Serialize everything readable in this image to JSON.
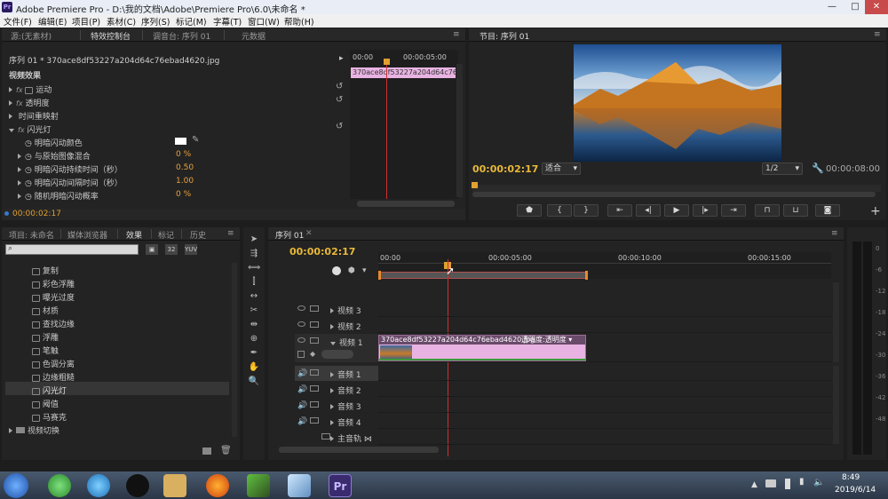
{
  "window": {
    "title": "Adobe Premiere Pro - D:\\我的文档\\Adobe\\Premiere Pro\\6.0\\未命名 *",
    "logo": "Pr"
  },
  "menu": [
    "文件(F)",
    "编辑(E)",
    "项目(P)",
    "素材(C)",
    "序列(S)",
    "标记(M)",
    "字幕(T)",
    "窗口(W)",
    "帮助(H)"
  ],
  "source_panel": {
    "tabs": [
      "源:(无素材)",
      "特效控制台",
      "调音台: 序列 01",
      "元数据"
    ],
    "clip_header": "序列 01 * 370ace8df53227a204d64c76ebad4620.jpg",
    "ruler": {
      "start": "00:00",
      "mid": "00:00:05:00"
    },
    "clip_label": "370ace8df53227a204d64c76ebad",
    "section": "视频效果",
    "effects": [
      {
        "label": "运动",
        "fx": "fx"
      },
      {
        "label": "透明度",
        "fx": "fx"
      },
      {
        "label": "时间重映射",
        "fx": ""
      },
      {
        "label": "闪光灯",
        "fx": "fx"
      }
    ],
    "params": [
      {
        "label": "明暗闪动颜色",
        "value": ""
      },
      {
        "label": "与原始图像混合",
        "value": "0 %"
      },
      {
        "label": "明暗闪动持续时间（秒）",
        "value": "0.50"
      },
      {
        "label": "明暗闪动间隔时间（秒）",
        "value": "1.00"
      },
      {
        "label": "随机明暗闪动概率",
        "value": "0 %"
      }
    ],
    "timecode": "00:00:02:17"
  },
  "program": {
    "tab": "节目: 序列 01",
    "timecode": "00:00:02:17",
    "fit": "适合",
    "scale": "1/2",
    "duration": "00:00:08:00"
  },
  "project_panel": {
    "tabs": [
      "项目: 未命名",
      "媒体浏览器",
      "效果",
      "标记",
      "历史"
    ],
    "items": [
      "复制",
      "彩色浮雕",
      "曝光过度",
      "材质",
      "查找边缘",
      "浮雕",
      "笔触",
      "色调分离",
      "边缘粗糙",
      "闪光灯",
      "阈值",
      "马赛克"
    ],
    "folder": "视频切换"
  },
  "timeline": {
    "tab": "序列 01",
    "timecode": "00:00:02:17",
    "ruler": [
      "00:00",
      "00:00:05:00",
      "00:00:10:00",
      "00:00:15:00"
    ],
    "video_tracks": [
      "视频 3",
      "视频 2",
      "视频 1"
    ],
    "audio_tracks": [
      "音频 1",
      "音频 2",
      "音频 3",
      "音频 4"
    ],
    "master": "主音轨",
    "clip": {
      "name": "370ace8df53227a204d64c76ebad4620.jpg",
      "effect": "透明度:透明度"
    }
  },
  "meter_ticks": [
    "0",
    "-6",
    "-12",
    "-18",
    "-24",
    "-30",
    "-36",
    "-42",
    "-48"
  ],
  "taskbar": {
    "time": "8:49",
    "date": "2019/6/14",
    "active_app": "Pr"
  },
  "colors": {
    "timecode": "#e8b838",
    "clip_pink": "#e8b3e2",
    "playhead": "#d03030",
    "accent_blue": "#3a78c8"
  }
}
